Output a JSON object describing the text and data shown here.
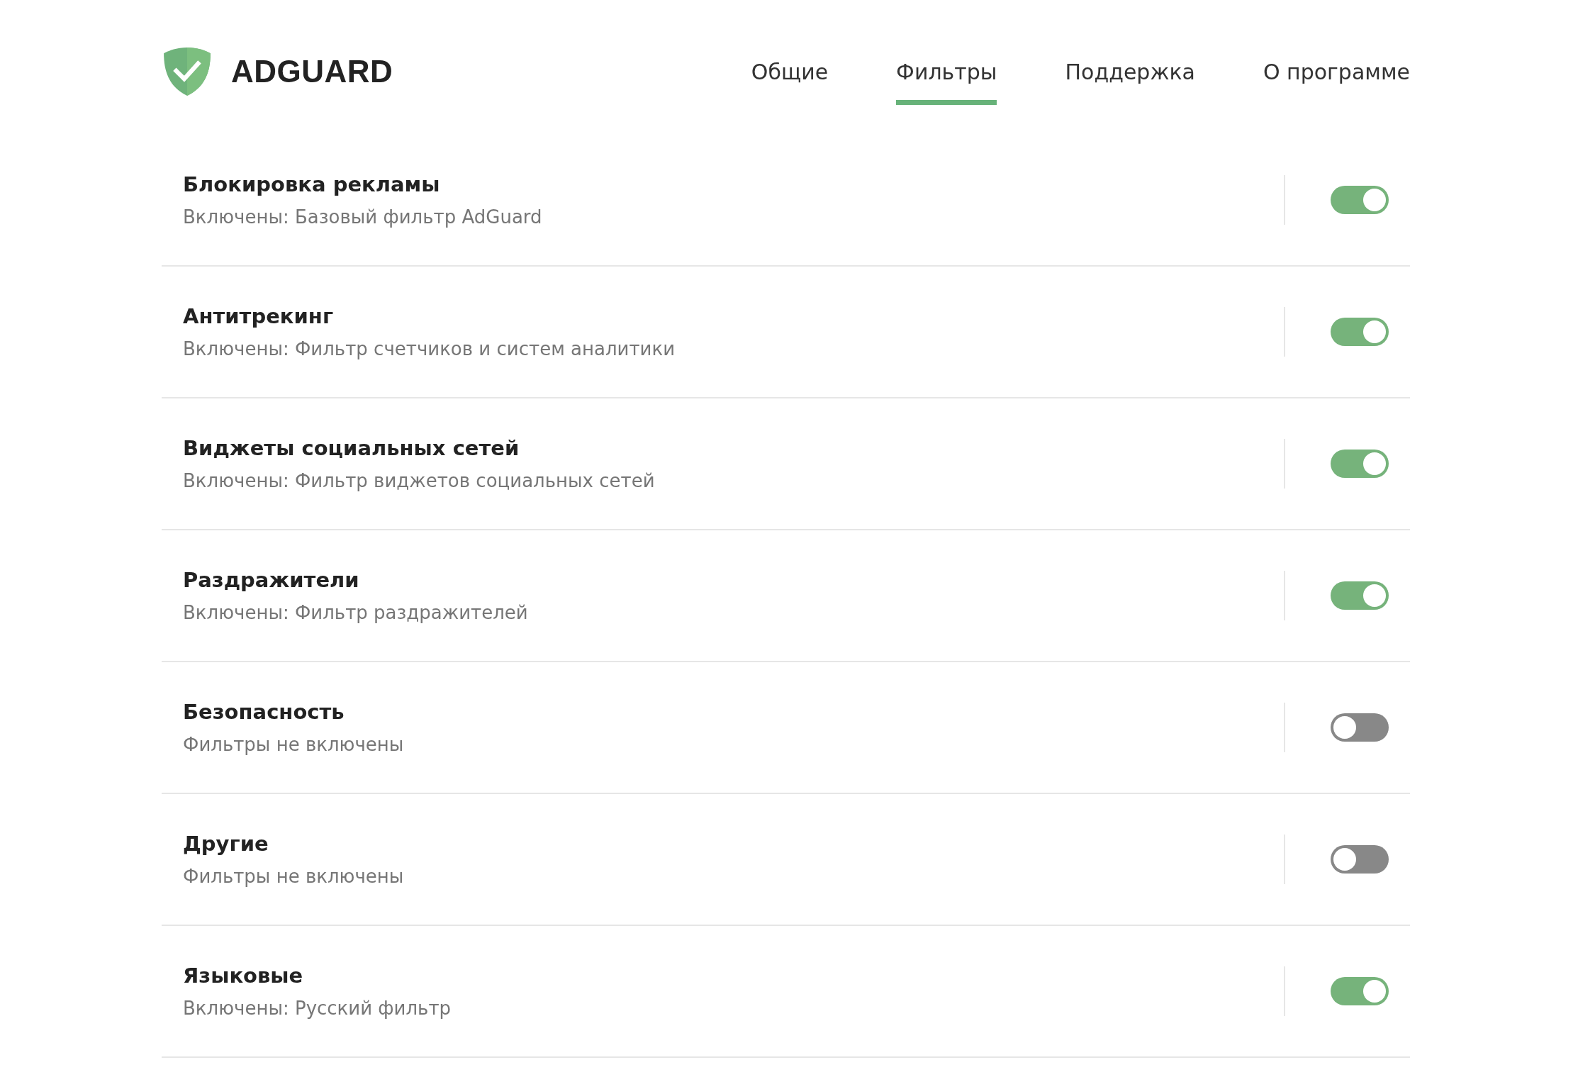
{
  "logo": {
    "text": "ADGUARD"
  },
  "tabs": [
    {
      "label": "Общие",
      "selected": false
    },
    {
      "label": "Фильтры",
      "selected": true
    },
    {
      "label": "Поддержка",
      "selected": false
    },
    {
      "label": "О программе",
      "selected": false
    }
  ],
  "filter_groups": [
    {
      "title": "Блокировка рекламы",
      "status": "Включены: Базовый фильтр AdGuard",
      "on": true
    },
    {
      "title": "Антитрекинг",
      "status": "Включены: Фильтр счетчиков и систем аналитики",
      "on": true
    },
    {
      "title": "Виджеты социальных сетей",
      "status": "Включены: Фильтр виджетов социальных сетей",
      "on": true
    },
    {
      "title": "Раздражители",
      "status": "Включены: Фильтр раздражителей",
      "on": true
    },
    {
      "title": "Безопасность",
      "status": "Фильтры не включены",
      "on": false
    },
    {
      "title": "Другие",
      "status": "Фильтры не включены",
      "on": false
    },
    {
      "title": "Языковые",
      "status": "Включены: Русский фильтр",
      "on": true
    }
  ]
}
